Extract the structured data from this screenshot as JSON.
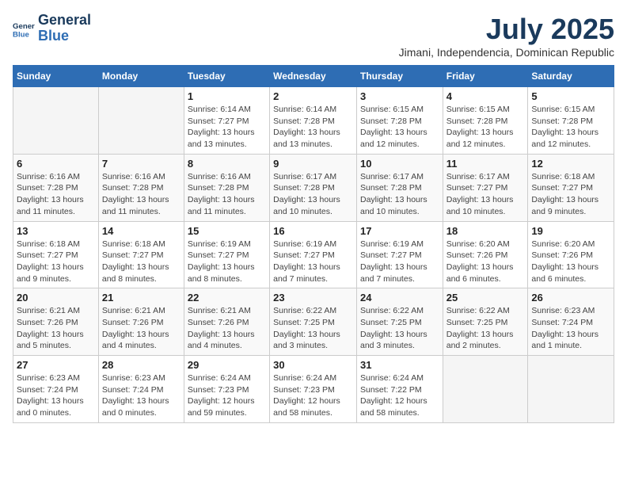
{
  "logo": {
    "line1": "General",
    "line2": "Blue"
  },
  "title": "July 2025",
  "subtitle": "Jimani, Independencia, Dominican Republic",
  "days_of_week": [
    "Sunday",
    "Monday",
    "Tuesday",
    "Wednesday",
    "Thursday",
    "Friday",
    "Saturday"
  ],
  "weeks": [
    [
      {
        "day": "",
        "content": ""
      },
      {
        "day": "",
        "content": ""
      },
      {
        "day": "1",
        "content": "Sunrise: 6:14 AM\nSunset: 7:27 PM\nDaylight: 13 hours and 13 minutes."
      },
      {
        "day": "2",
        "content": "Sunrise: 6:14 AM\nSunset: 7:28 PM\nDaylight: 13 hours and 13 minutes."
      },
      {
        "day": "3",
        "content": "Sunrise: 6:15 AM\nSunset: 7:28 PM\nDaylight: 13 hours and 12 minutes."
      },
      {
        "day": "4",
        "content": "Sunrise: 6:15 AM\nSunset: 7:28 PM\nDaylight: 13 hours and 12 minutes."
      },
      {
        "day": "5",
        "content": "Sunrise: 6:15 AM\nSunset: 7:28 PM\nDaylight: 13 hours and 12 minutes."
      }
    ],
    [
      {
        "day": "6",
        "content": "Sunrise: 6:16 AM\nSunset: 7:28 PM\nDaylight: 13 hours and 11 minutes."
      },
      {
        "day": "7",
        "content": "Sunrise: 6:16 AM\nSunset: 7:28 PM\nDaylight: 13 hours and 11 minutes."
      },
      {
        "day": "8",
        "content": "Sunrise: 6:16 AM\nSunset: 7:28 PM\nDaylight: 13 hours and 11 minutes."
      },
      {
        "day": "9",
        "content": "Sunrise: 6:17 AM\nSunset: 7:28 PM\nDaylight: 13 hours and 10 minutes."
      },
      {
        "day": "10",
        "content": "Sunrise: 6:17 AM\nSunset: 7:28 PM\nDaylight: 13 hours and 10 minutes."
      },
      {
        "day": "11",
        "content": "Sunrise: 6:17 AM\nSunset: 7:27 PM\nDaylight: 13 hours and 10 minutes."
      },
      {
        "day": "12",
        "content": "Sunrise: 6:18 AM\nSunset: 7:27 PM\nDaylight: 13 hours and 9 minutes."
      }
    ],
    [
      {
        "day": "13",
        "content": "Sunrise: 6:18 AM\nSunset: 7:27 PM\nDaylight: 13 hours and 9 minutes."
      },
      {
        "day": "14",
        "content": "Sunrise: 6:18 AM\nSunset: 7:27 PM\nDaylight: 13 hours and 8 minutes."
      },
      {
        "day": "15",
        "content": "Sunrise: 6:19 AM\nSunset: 7:27 PM\nDaylight: 13 hours and 8 minutes."
      },
      {
        "day": "16",
        "content": "Sunrise: 6:19 AM\nSunset: 7:27 PM\nDaylight: 13 hours and 7 minutes."
      },
      {
        "day": "17",
        "content": "Sunrise: 6:19 AM\nSunset: 7:27 PM\nDaylight: 13 hours and 7 minutes."
      },
      {
        "day": "18",
        "content": "Sunrise: 6:20 AM\nSunset: 7:26 PM\nDaylight: 13 hours and 6 minutes."
      },
      {
        "day": "19",
        "content": "Sunrise: 6:20 AM\nSunset: 7:26 PM\nDaylight: 13 hours and 6 minutes."
      }
    ],
    [
      {
        "day": "20",
        "content": "Sunrise: 6:21 AM\nSunset: 7:26 PM\nDaylight: 13 hours and 5 minutes."
      },
      {
        "day": "21",
        "content": "Sunrise: 6:21 AM\nSunset: 7:26 PM\nDaylight: 13 hours and 4 minutes."
      },
      {
        "day": "22",
        "content": "Sunrise: 6:21 AM\nSunset: 7:26 PM\nDaylight: 13 hours and 4 minutes."
      },
      {
        "day": "23",
        "content": "Sunrise: 6:22 AM\nSunset: 7:25 PM\nDaylight: 13 hours and 3 minutes."
      },
      {
        "day": "24",
        "content": "Sunrise: 6:22 AM\nSunset: 7:25 PM\nDaylight: 13 hours and 3 minutes."
      },
      {
        "day": "25",
        "content": "Sunrise: 6:22 AM\nSunset: 7:25 PM\nDaylight: 13 hours and 2 minutes."
      },
      {
        "day": "26",
        "content": "Sunrise: 6:23 AM\nSunset: 7:24 PM\nDaylight: 13 hours and 1 minute."
      }
    ],
    [
      {
        "day": "27",
        "content": "Sunrise: 6:23 AM\nSunset: 7:24 PM\nDaylight: 13 hours and 0 minutes."
      },
      {
        "day": "28",
        "content": "Sunrise: 6:23 AM\nSunset: 7:24 PM\nDaylight: 13 hours and 0 minutes."
      },
      {
        "day": "29",
        "content": "Sunrise: 6:24 AM\nSunset: 7:23 PM\nDaylight: 12 hours and 59 minutes."
      },
      {
        "day": "30",
        "content": "Sunrise: 6:24 AM\nSunset: 7:23 PM\nDaylight: 12 hours and 58 minutes."
      },
      {
        "day": "31",
        "content": "Sunrise: 6:24 AM\nSunset: 7:22 PM\nDaylight: 12 hours and 58 minutes."
      },
      {
        "day": "",
        "content": ""
      },
      {
        "day": "",
        "content": ""
      }
    ]
  ]
}
